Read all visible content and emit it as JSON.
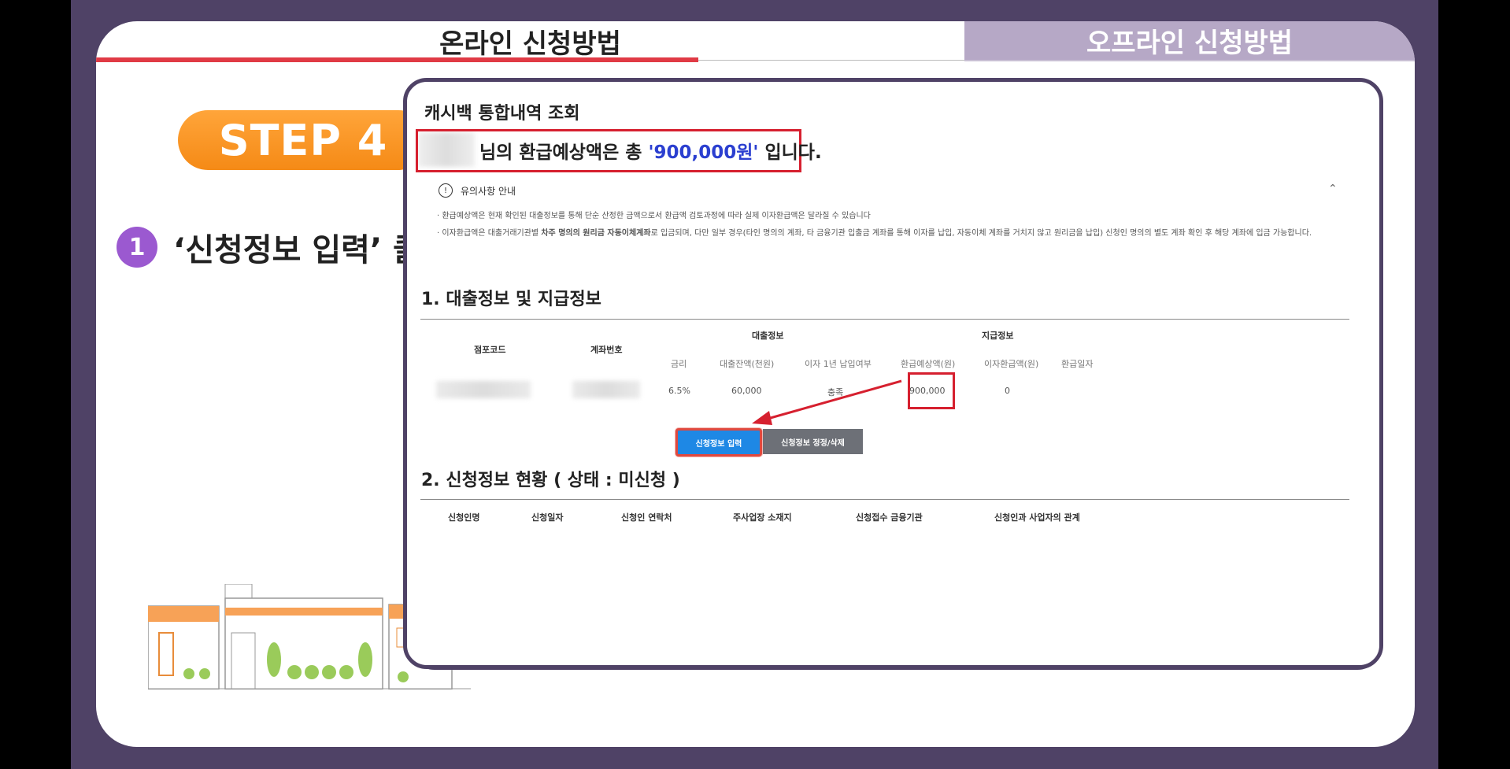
{
  "tabs": {
    "online": "온라인 신청방법",
    "offline": "오프라인 신청방법"
  },
  "step": {
    "label": "STEP 4",
    "number": "1",
    "instruction": "‘신청정보 입력’ 클릭!"
  },
  "panel": {
    "title": "캐시백 통합내역 조회",
    "refund_prefix": "님의 환급예상액은 총 ",
    "refund_amount": "'900,000원'",
    "refund_suffix": " 입니다.",
    "notice_title": "유의사항 안내",
    "notice_1": "· 환급예상액은 현재 확인된 대출정보를 통해 단순 산정한 금액으로서 환급액 검토과정에 따라 실제 이자환급액은 달라질 수 있습니다",
    "notice_2a": "· 이자환급액은 대출거래기관별 ",
    "notice_2b": "차주 명의의 원리금 자동이체계좌",
    "notice_2c": "로 입금되며, 다만 일부 경우(타인 명의의 계좌, 타 금융기관 입출금 계좌를 통해 이자를 납입, 자동이체 계좌를 거치지 않고 원리금을 납입) 신청인 명의의 별도 계좌 확인 후 해당 계좌에 입금 가능합니다.",
    "section1": "1. 대출정보 및 지급정보",
    "section2": "2. 신청정보 현황 ( 상태 : 미신청 )",
    "table1": {
      "col_branch": "점포코드",
      "col_account": "계좌번호",
      "group_loan": "대출정보",
      "group_pay": "지급정보",
      "sub_rate": "금리",
      "sub_balance": "대출잔액(천원)",
      "sub_interest": "이자 1년 납입여부",
      "sub_refund": "환급예상액(원)",
      "sub_paid": "이자환급액(원)",
      "sub_date": "환급일자",
      "row": {
        "rate": "6.5%",
        "balance": "60,000",
        "interest": "충족",
        "refund": "900,000",
        "paid": "0"
      }
    },
    "buttons": {
      "apply": "신청정보 입력",
      "edit": "신청정보 정정/삭제"
    },
    "table2": {
      "cols": [
        "신청인명",
        "신청일자",
        "신청인 연락처",
        "주사업장 소재지",
        "신청접수 금융기관",
        "신청인과 사업자의 관계"
      ]
    }
  },
  "colors": {
    "accent_red": "#d6202f",
    "step_orange": "#f58a16",
    "purple": "#4f4266",
    "button_blue": "#1e88e5",
    "amount_blue": "#2b3fd0"
  }
}
